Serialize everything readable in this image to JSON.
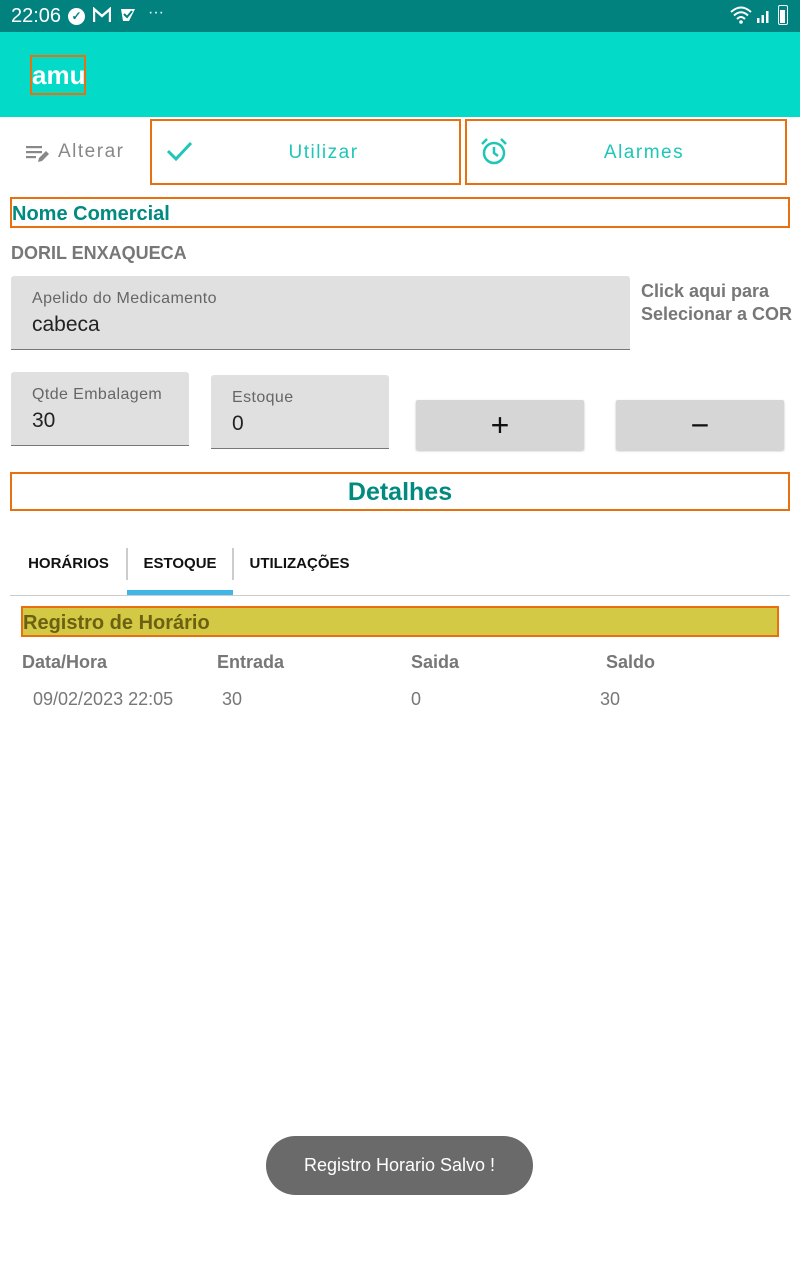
{
  "status_bar": {
    "time": "22:06",
    "more": "···"
  },
  "app": {
    "title": "amu"
  },
  "toolbar": {
    "alterar_label": "Alterar",
    "utilizar_label": "Utilizar",
    "alarmes_label": "Alarmes"
  },
  "nome_comercial": {
    "heading": "Nome Comercial",
    "value": "DORIL ENXAQUECA"
  },
  "apelido": {
    "label": "Apelido do Medicamento",
    "value": "cabeca"
  },
  "cor_hint": {
    "line1": "Click aqui para",
    "line2": "Selecionar a COR"
  },
  "qtde": {
    "label": "Qtde Embalagem",
    "value": "30"
  },
  "estoque": {
    "label": "Estoque",
    "value": "0"
  },
  "stepper": {
    "plus": "+",
    "minus": "−"
  },
  "detalhes": {
    "heading": "Detalhes"
  },
  "tabs": [
    {
      "label": "HORÁRIOS"
    },
    {
      "label": "ESTOQUE"
    },
    {
      "label": "UTILIZAÇÕES"
    }
  ],
  "selected_tab": "ESTOQUE",
  "registro": {
    "heading": "Registro de Horário"
  },
  "table": {
    "headers": [
      "Data/Hora",
      "Entrada",
      "Saida",
      "Saldo"
    ],
    "rows": [
      [
        "09/02/2023 22:05",
        "30",
        "0",
        "30"
      ]
    ]
  },
  "toast": {
    "message": "Registro Horario Salvo !"
  },
  "colors": {
    "status_bar": "#01827f",
    "app_bar": "#03dac8",
    "accent_border": "#e8700f",
    "teal_text": "#008a80",
    "tab_indicator": "#3fb6e8",
    "registro_bg": "#d4c944"
  }
}
